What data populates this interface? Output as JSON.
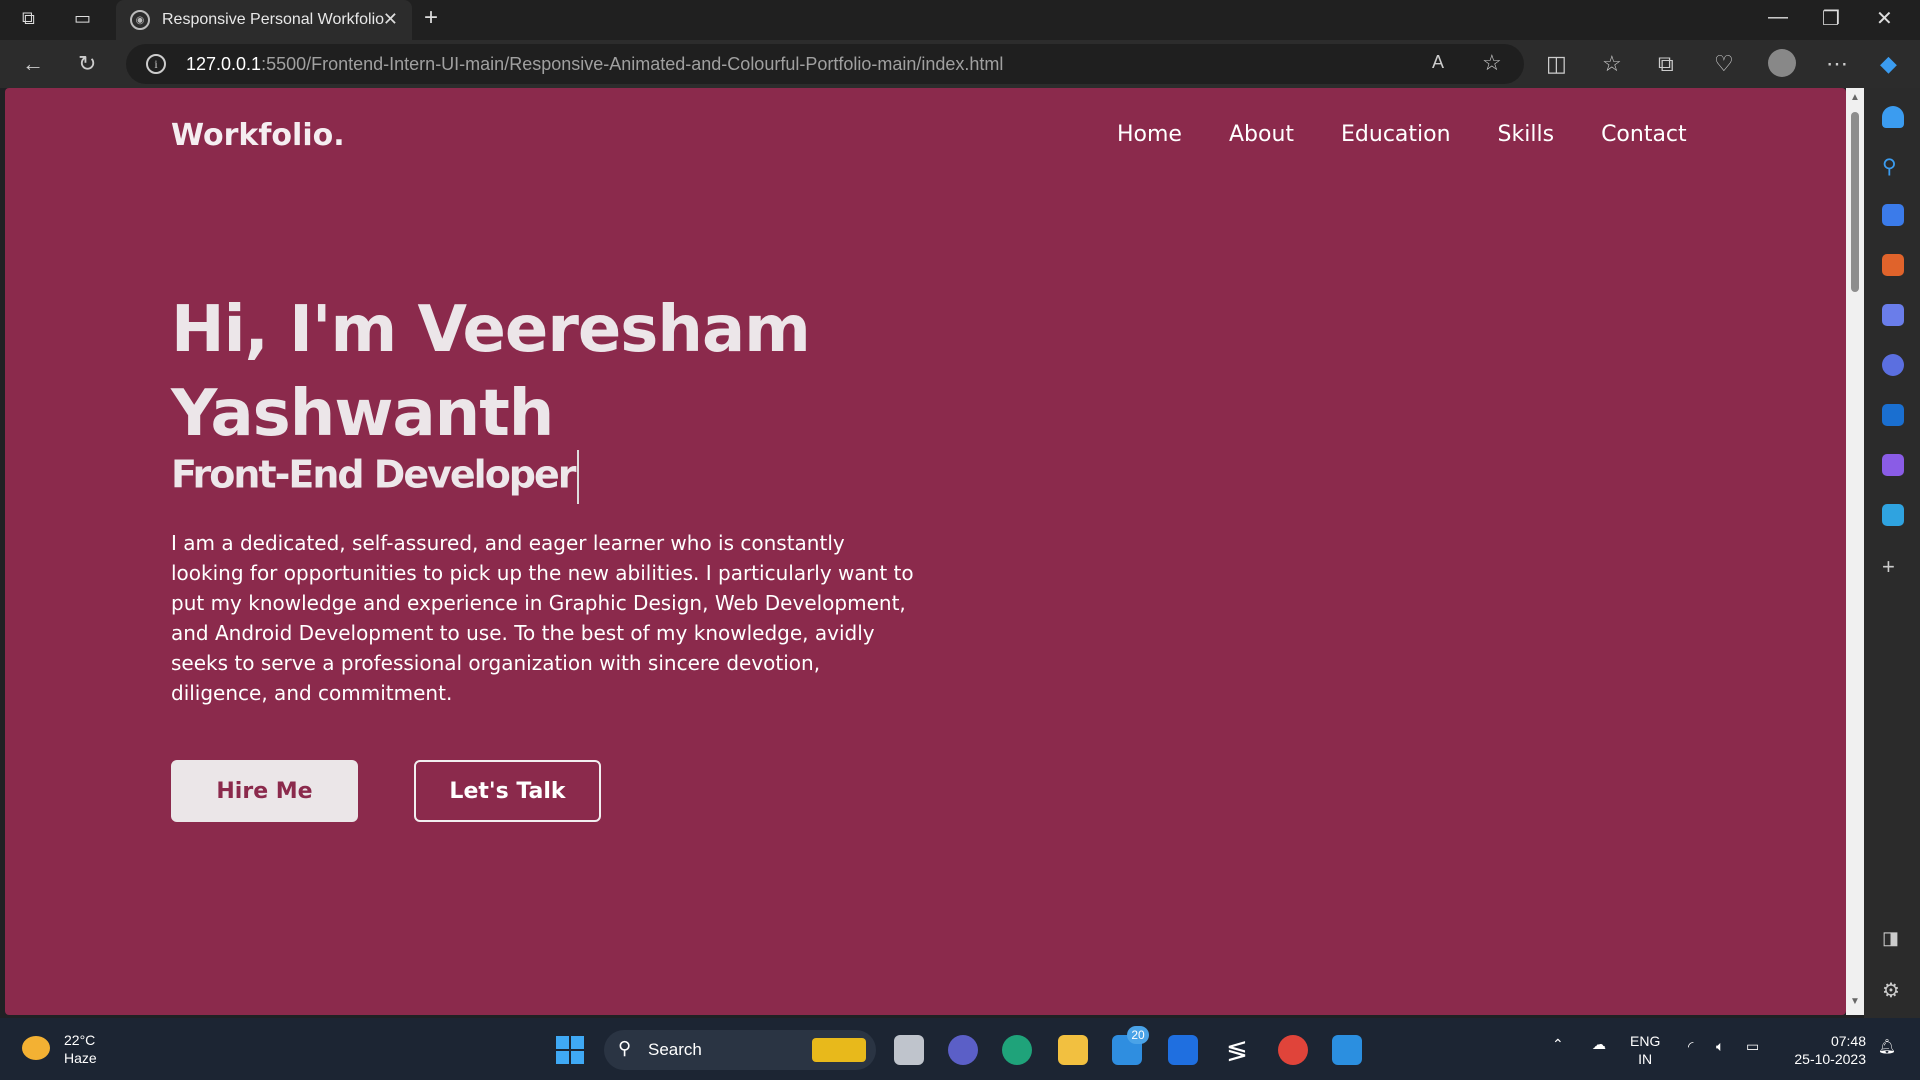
{
  "browser": {
    "tab_title": "Responsive Personal Workfolio",
    "url_host": "127.0.0.1",
    "url_rest": ":5500/Frontend-Intern-UI-main/Responsive-Animated-and-Colourful-Portfolio-main/index.html"
  },
  "site": {
    "logo": "Workfolio.",
    "nav": [
      "Home",
      "About",
      "Education",
      "Skills",
      "Contact"
    ],
    "hero_line1": "Hi, I'm Veeresham",
    "hero_line2": "Yashwanth",
    "hero_subtitle": "Front-End Developer",
    "hero_paragraph": "I am a dedicated, self-assured, and eager learner who is constantly looking for opportunities to pick up the new abilities. I particularly want to put my knowledge and experience in Graphic Design, Web Development, and Android Development to use. To the best of my knowledge, avidly seeks to serve a professional organization with sincere devotion, diligence, and commitment.",
    "hire_button": "Hire Me",
    "talk_button": "Let's Talk"
  },
  "taskbar": {
    "temperature": "22°C",
    "weather": "Haze",
    "search_label": "Search",
    "mail_badge": "20",
    "lang_line1": "ENG",
    "lang_line2": "IN",
    "time": "07:48",
    "date": "25-10-2023"
  },
  "colors": {
    "page_bg": "#8b2a4c",
    "browser_chrome": "#2c2c2c",
    "taskbar": "#1c2533"
  }
}
